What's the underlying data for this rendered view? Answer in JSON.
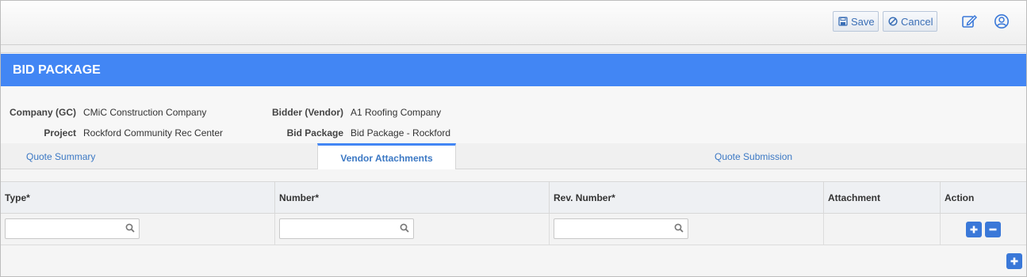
{
  "toolbar": {
    "save_label": "Save",
    "cancel_label": "Cancel",
    "icons": [
      "save-icon",
      "cancel-icon",
      "edit-icon",
      "user-icon"
    ]
  },
  "header": {
    "title": "BID PACKAGE"
  },
  "info": {
    "company_label": "Company (GC)",
    "company_value": "CMiC Construction Company",
    "project_label": "Project",
    "project_value": "Rockford Community Rec Center",
    "bidder_label": "Bidder (Vendor)",
    "bidder_value": "A1 Roofing Company",
    "bidpackage_label": "Bid Package",
    "bidpackage_value": "Bid Package - Rockford"
  },
  "tabs": [
    {
      "label": "Quote Summary",
      "active": false
    },
    {
      "label": "Vendor Attachments",
      "active": true
    },
    {
      "label": "Quote Submission",
      "active": false
    }
  ],
  "grid": {
    "columns": [
      "Type*",
      "Number*",
      "Rev. Number*",
      "Attachment",
      "Action"
    ],
    "rows": [
      {
        "type": "",
        "number": "",
        "rev_number": "",
        "attachment": ""
      }
    ]
  },
  "colors": {
    "accent": "#4286f4",
    "button": "#3a78d8",
    "link": "#3b78c4"
  }
}
